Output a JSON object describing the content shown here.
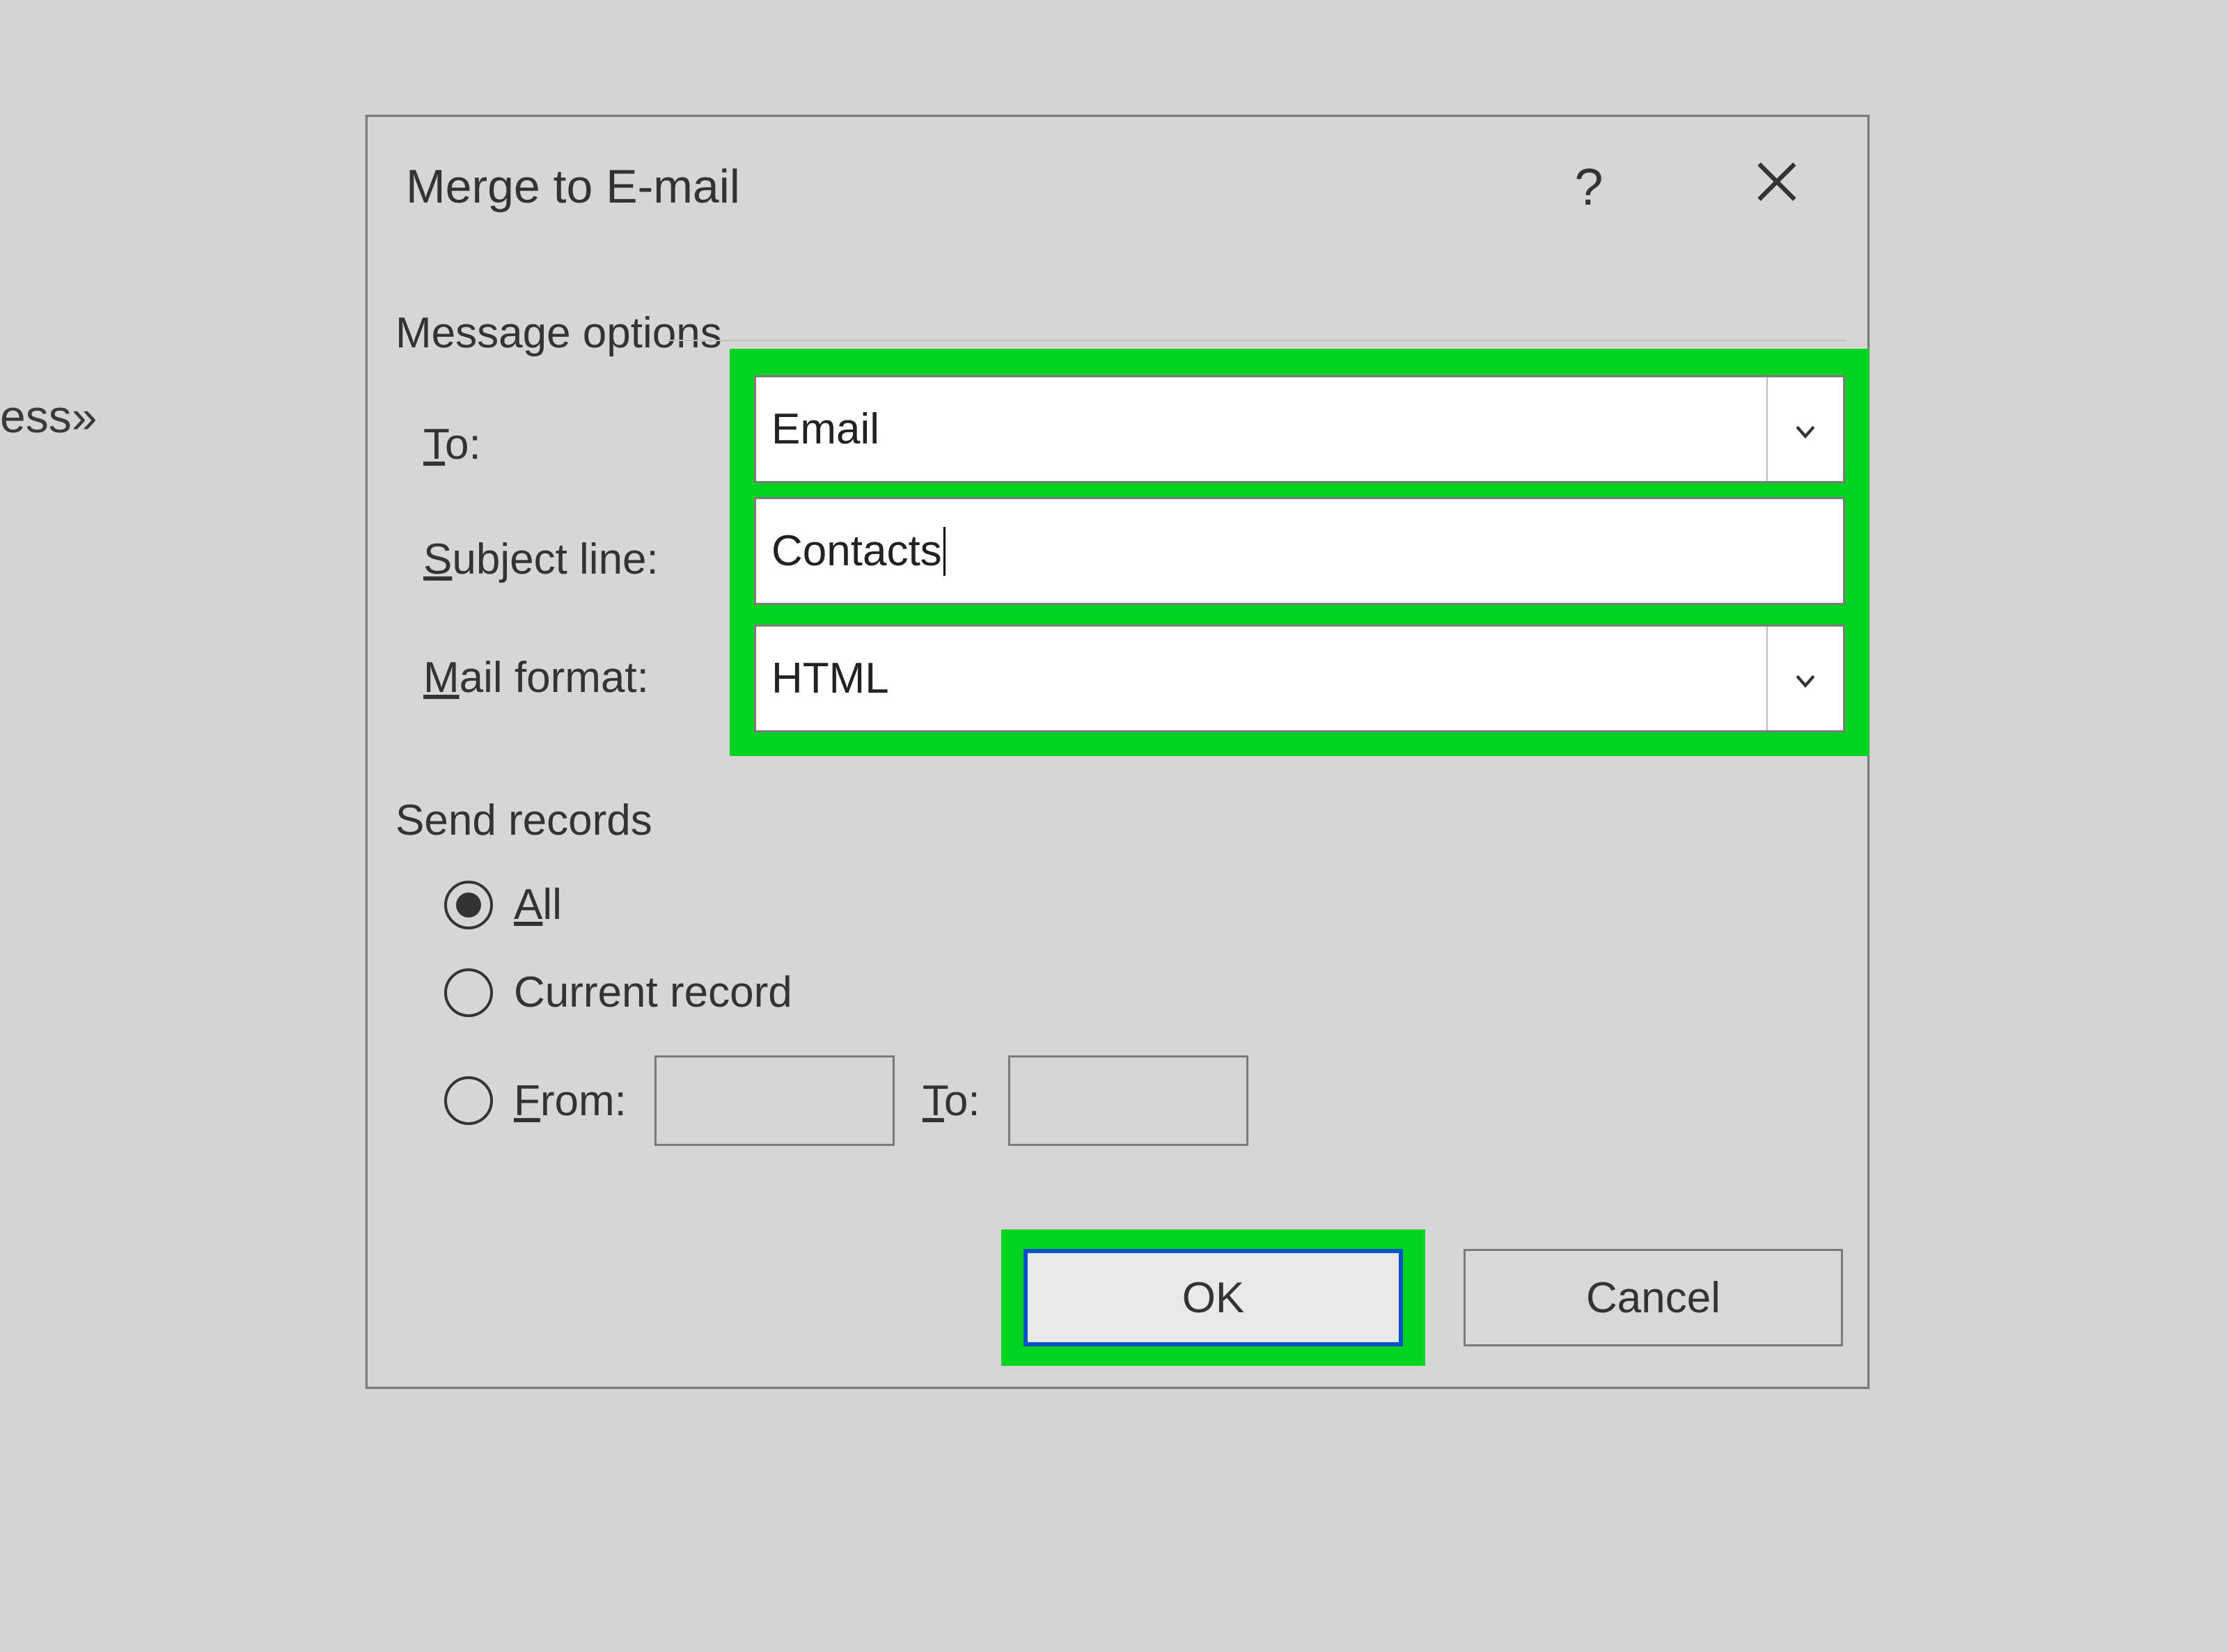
{
  "background_fragment": "ess»",
  "dialog": {
    "title": "Merge to E-mail",
    "help_symbol": "?",
    "message_options": {
      "group_label": "Message options",
      "to_label": "To:",
      "to_value": "Email",
      "subject_label": "Subject line:",
      "subject_value": "Contacts",
      "format_label": "Mail format:",
      "format_value": "HTML"
    },
    "send_records": {
      "group_label": "Send records",
      "all_label": "All",
      "current_label": "Current record",
      "from_label": "From:",
      "to_label": "To:",
      "selected": "all"
    },
    "buttons": {
      "ok": "OK",
      "cancel": "Cancel"
    }
  }
}
